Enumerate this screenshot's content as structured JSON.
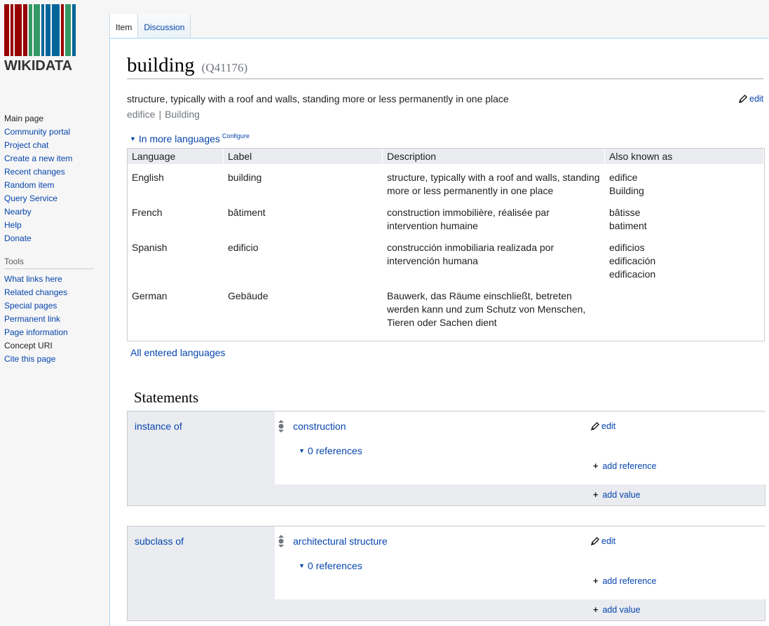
{
  "logo": {
    "text": "WIKIDATA",
    "bar_colors": [
      "#990000",
      "#990000",
      "#990000",
      "#990000",
      "#339966",
      "#339966",
      "#006699",
      "#006699",
      "#006699",
      "#990000",
      "#339966",
      "#006699"
    ]
  },
  "sidebar": {
    "nav": [
      {
        "label": "Main page",
        "dark": true
      },
      {
        "label": "Community portal"
      },
      {
        "label": "Project chat"
      },
      {
        "label": "Create a new item"
      },
      {
        "label": "Recent changes"
      },
      {
        "label": "Random item"
      },
      {
        "label": "Query Service"
      },
      {
        "label": "Nearby"
      },
      {
        "label": "Help"
      },
      {
        "label": "Donate"
      }
    ],
    "tools_heading": "Tools",
    "tools": [
      {
        "label": "What links here"
      },
      {
        "label": "Related changes"
      },
      {
        "label": "Special pages"
      },
      {
        "label": "Permanent link"
      },
      {
        "label": "Page information"
      },
      {
        "label": "Concept URI",
        "dark": true
      },
      {
        "label": "Cite this page"
      }
    ]
  },
  "tabs": [
    {
      "label": "Item",
      "selected": true
    },
    {
      "label": "Discussion",
      "selected": false
    }
  ],
  "item": {
    "label": "building",
    "id": "(Q41176)",
    "description": "structure, typically with a roof and walls, standing more or less permanently in one place",
    "aliases": [
      "edifice",
      "Building"
    ],
    "alias_separator": "|",
    "edit_label": "edit"
  },
  "languages": {
    "toggle_label": "In more languages",
    "configure_label": "Configure",
    "headers": {
      "language": "Language",
      "label": "Label",
      "description": "Description",
      "aliases": "Also known as"
    },
    "rows": [
      {
        "language": "English",
        "label": "building",
        "description": [
          "structure, typically with a roof and walls, standing",
          "more or less permanently in one place"
        ],
        "aliases": [
          "edifice",
          "Building"
        ]
      },
      {
        "language": "French",
        "label": "bâtiment",
        "description": [
          "construction immobilière, réalisée par",
          "intervention humaine"
        ],
        "aliases": [
          "bâtisse",
          "batiment"
        ]
      },
      {
        "language": "Spanish",
        "label": "edificio",
        "description": [
          "construcción inmobiliaria realizada por",
          "intervención humana"
        ],
        "aliases": [
          "edificios",
          "edificación",
          "edificacion"
        ]
      },
      {
        "language": "German",
        "label": "Gebäude",
        "description": [
          "Bauwerk, das Räume einschließt, betreten",
          "werden kann und zum Schutz von Menschen,",
          "Tieren oder Sachen dient"
        ],
        "aliases": []
      }
    ],
    "all_languages_link": "All entered languages"
  },
  "statements": {
    "heading": "Statements",
    "items": [
      {
        "property": "instance of",
        "value": "construction",
        "references": "0 references",
        "edit": "edit",
        "add_reference": "add reference",
        "add_value": "add value"
      },
      {
        "property": "subclass of",
        "value": "architectural structure",
        "references": "0 references",
        "edit": "edit",
        "add_reference": "add reference",
        "add_value": "add value"
      }
    ]
  }
}
